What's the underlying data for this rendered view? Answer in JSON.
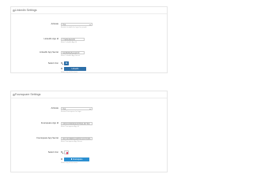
{
  "linkedin": {
    "title": "LinkedIn Settings",
    "activate": {
      "label": "Activate",
      "value": "Yes",
      "hint": "Enable LinkedIn for login for people"
    },
    "app_id": {
      "label": "LinkedIn App Id",
      "value": "77a09u9u0c6t",
      "hint": "Enter LinkedIn App Id"
    },
    "app_secret": {
      "label": "LinkedIn App Secret",
      "value": "bxkf6j4Sq6yqqAUX",
      "hint": "Enter LinkedIn App Secret"
    },
    "select_icon": {
      "label": "Select Icon",
      "option1": "in",
      "option2": "LinkedIn",
      "hint": "Select any of the icons"
    }
  },
  "foursquare": {
    "title": "Foursquare Settings",
    "activate": {
      "label": "Activate",
      "value": "Yes",
      "hint": "Enable Foursquare for login"
    },
    "app_id": {
      "label": "Foursquare App Id",
      "value": "UDVUQ3WDGUMTNCLMYKM",
      "hint": "Enter Foursquare App Id"
    },
    "app_secret": {
      "label": "Foursquare App Secret",
      "value": "JDVUQ3WDGUMTNCLMYKMA",
      "hint": "Enter Foursquare App Secret"
    },
    "select_icon": {
      "label": "Select Icon",
      "option1": "",
      "option2": "Foursquare",
      "hint": "Select any of the icons"
    }
  },
  "colors": {
    "linkedin_blue": "#2d6fa8",
    "foursquare_blue": "#2b8fd1",
    "foursquare_pink": "#e24a6b"
  }
}
